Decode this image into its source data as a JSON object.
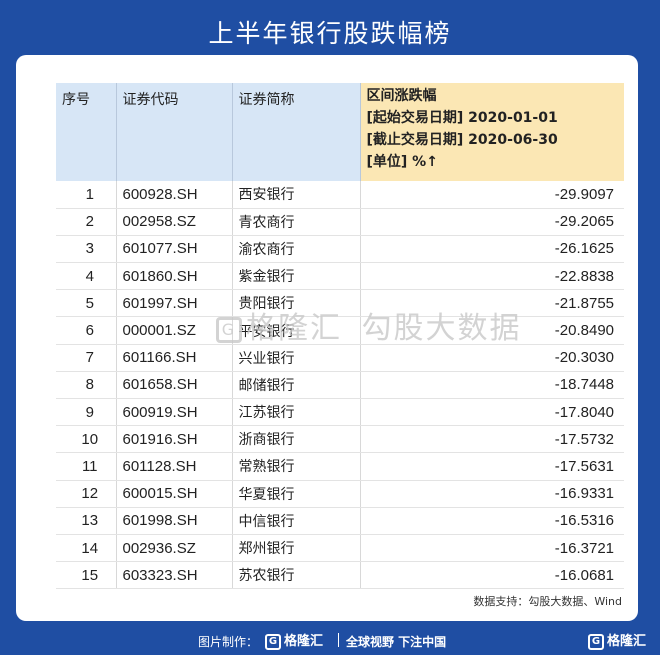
{
  "title": "上半年银行股跌幅榜",
  "table": {
    "headers": {
      "index": "序号",
      "code": "证券代码",
      "name": "证券简称",
      "change_lines": [
        "区间涨跌幅",
        "[起始交易日期] 2020-01-01",
        "[截止交易日期] 2020-06-30",
        "[单位] %↑"
      ]
    },
    "rows": [
      {
        "index": "1",
        "code": "600928.SH",
        "name": "西安银行",
        "change": "-29.9097"
      },
      {
        "index": "2",
        "code": "002958.SZ",
        "name": "青农商行",
        "change": "-29.2065"
      },
      {
        "index": "3",
        "code": "601077.SH",
        "name": "渝农商行",
        "change": "-26.1625"
      },
      {
        "index": "4",
        "code": "601860.SH",
        "name": "紫金银行",
        "change": "-22.8838"
      },
      {
        "index": "5",
        "code": "601997.SH",
        "name": "贵阳银行",
        "change": "-21.8755"
      },
      {
        "index": "6",
        "code": "000001.SZ",
        "name": "平安银行",
        "change": "-20.8490"
      },
      {
        "index": "7",
        "code": "601166.SH",
        "name": "兴业银行",
        "change": "-20.3030"
      },
      {
        "index": "8",
        "code": "601658.SH",
        "name": "邮储银行",
        "change": "-18.7448"
      },
      {
        "index": "9",
        "code": "600919.SH",
        "name": "江苏银行",
        "change": "-17.8040"
      },
      {
        "index": "10",
        "code": "601916.SH",
        "name": "浙商银行",
        "change": "-17.5732"
      },
      {
        "index": "11",
        "code": "601128.SH",
        "name": "常熟银行",
        "change": "-17.5631"
      },
      {
        "index": "12",
        "code": "600015.SH",
        "name": "华夏银行",
        "change": "-16.9331"
      },
      {
        "index": "13",
        "code": "601998.SH",
        "name": "中信银行",
        "change": "-16.5316"
      },
      {
        "index": "14",
        "code": "002936.SZ",
        "name": "郑州银行",
        "change": "-16.3721"
      },
      {
        "index": "15",
        "code": "603323.SH",
        "name": "苏农银行",
        "change": "-16.0681"
      }
    ]
  },
  "watermark": {
    "brand": "格隆汇",
    "text": "勾股大数据"
  },
  "source": "数据支持：勾股大数据、Wind",
  "footer": {
    "credit": "图片制作：",
    "logo_text": "格隆汇",
    "slogan": "全球视野 下注中国",
    "right_logo": "格隆汇"
  },
  "colors": {
    "background": "#1f4ea3",
    "header": "#d7e6f6",
    "highlight_header": "#fbe7b4"
  }
}
